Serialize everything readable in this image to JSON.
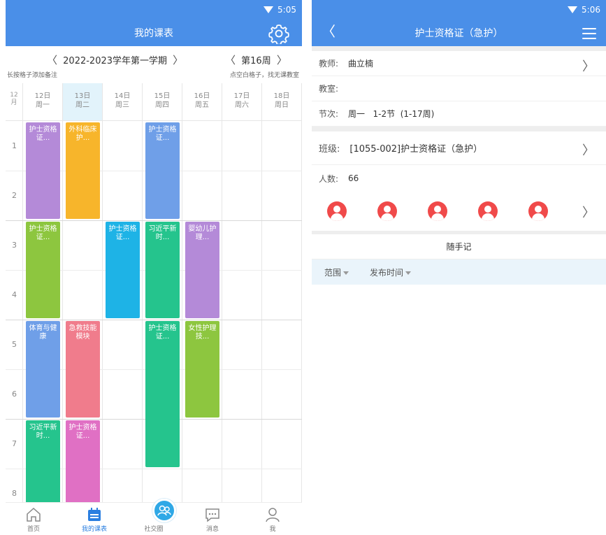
{
  "left": {
    "status_time": "5:05",
    "title": "我的课表",
    "term": "2022-2023学年第一学期",
    "week": "第16周",
    "hint_left": "长按格子添加备注",
    "hint_right": "点空白格子，找无课教室",
    "month": "12\n月",
    "days": [
      {
        "date": "12日",
        "weekday": "周一",
        "today": false
      },
      {
        "date": "13日",
        "weekday": "周二",
        "today": true
      },
      {
        "date": "14日",
        "weekday": "周三",
        "today": false
      },
      {
        "date": "15日",
        "weekday": "周四",
        "today": false
      },
      {
        "date": "16日",
        "weekday": "周五",
        "today": false
      },
      {
        "date": "17日",
        "weekday": "周六",
        "today": false
      },
      {
        "date": "18日",
        "weekday": "周日",
        "today": false
      }
    ],
    "slots": [
      "1",
      "2",
      "3",
      "4",
      "5",
      "6",
      "7",
      "8"
    ],
    "courses": [
      {
        "day": 0,
        "start": 0,
        "span": 2,
        "text": "护士资格证...",
        "color": "#b48ad8"
      },
      {
        "day": 1,
        "start": 0,
        "span": 2,
        "text": "外科临床护...",
        "color": "#f7b52b"
      },
      {
        "day": 3,
        "start": 0,
        "span": 2,
        "text": "护士资格证...",
        "color": "#6f9fe8"
      },
      {
        "day": 0,
        "start": 2,
        "span": 2,
        "text": "护士资格证...",
        "color": "#8dc63f"
      },
      {
        "day": 2,
        "start": 2,
        "span": 2,
        "text": "护士资格证...",
        "color": "#1eb3e6"
      },
      {
        "day": 3,
        "start": 2,
        "span": 2,
        "text": "习近平新时...",
        "color": "#25c48d"
      },
      {
        "day": 4,
        "start": 2,
        "span": 2,
        "text": "婴幼儿护理...",
        "color": "#b48ad8"
      },
      {
        "day": 0,
        "start": 4,
        "span": 2,
        "text": "体育与健康",
        "color": "#6f9fe8"
      },
      {
        "day": 1,
        "start": 4,
        "span": 2,
        "text": "急救技能模块",
        "color": "#f07c8c"
      },
      {
        "day": 3,
        "start": 4,
        "span": 3,
        "text": "护士资格证...",
        "color": "#25c48d"
      },
      {
        "day": 4,
        "start": 4,
        "span": 2,
        "text": "女性护理技...",
        "color": "#8dc63f"
      },
      {
        "day": 0,
        "start": 6,
        "span": 2,
        "text": "习近平新时...",
        "color": "#25c48d"
      },
      {
        "day": 1,
        "start": 6,
        "span": 2,
        "text": "护士资格证...",
        "color": "#e070c4"
      }
    ],
    "nav": [
      {
        "label": "首页",
        "icon": "home-icon"
      },
      {
        "label": "我的课表",
        "icon": "calendar-icon",
        "active": true
      },
      {
        "label": "社交圈",
        "icon": "social-icon"
      },
      {
        "label": "消息",
        "icon": "message-icon"
      },
      {
        "label": "我",
        "icon": "user-icon"
      }
    ]
  },
  "right": {
    "status_time": "5:06",
    "title": "护士资格证（急护）",
    "teacher_label": "教师:",
    "teacher": "曲立楠",
    "room_label": "教室:",
    "room": "",
    "period_label": "节次:",
    "period": "周一   1-2节  (1-17周)",
    "class_label": "班级:",
    "class_name": "[1055-002]护士资格证（急护）",
    "count_label": "人数:",
    "count": "66",
    "notes_title": "随手记",
    "filter_scope": "范围",
    "filter_time": "发布时间"
  },
  "colors": {
    "primary": "#4a8fe8",
    "active": "#2b7fe0",
    "avatar": "#f04a4a"
  }
}
